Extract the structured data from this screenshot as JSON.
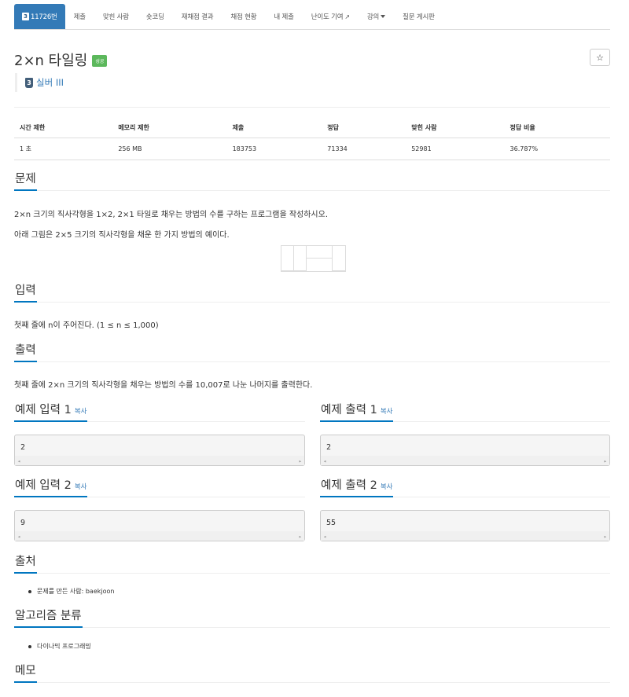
{
  "nav": {
    "problem_number": "11726번",
    "problem_tier": "3",
    "tabs": [
      "제출",
      "맞힌 사람",
      "숏코딩",
      "재채점 결과",
      "채점 현황",
      "내 제출",
      "난이도 기여",
      "강의",
      "질문 게시판"
    ]
  },
  "problem": {
    "title": "2×n 타일링",
    "status_label": "성공",
    "star_icon": "☆",
    "tier_badge": "3",
    "tier_name": "실버 III"
  },
  "info_table": {
    "headers": [
      "시간 제한",
      "메모리 제한",
      "제출",
      "정답",
      "맞힌 사람",
      "정답 비율"
    ],
    "values": [
      "1 초",
      "256 MB",
      "183753",
      "71334",
      "52981",
      "36.787%"
    ]
  },
  "sections": {
    "description_title": "문제",
    "description_p1": "2×n 크기의 직사각형을 1×2, 2×1 타일로 채우는 방법의 수를 구하는 프로그램을 작성하시오.",
    "description_p2": "아래 그림은 2×5 크기의 직사각형을 채운 한 가지 방법의 예이다.",
    "input_title": "입력",
    "input_text": "첫째 줄에 n이 주어진다. (1 ≤ n ≤ 1,000)",
    "output_title": "출력",
    "output_text": "첫째 줄에 2×n 크기의 직사각형을 채우는 방법의 수를 10,007로 나눈 나머지를 출력한다.",
    "source_title": "출처",
    "source_item": "문제를 만든 사람: baekjoon",
    "algorithm_title": "알고리즘 분류",
    "algorithm_item": "다이나믹 프로그래밍",
    "memo_title": "메모"
  },
  "samples": {
    "copy_label": "복사",
    "input1_title": "예제 입력 1",
    "output1_title": "예제 출력 1",
    "input2_title": "예제 입력 2",
    "output2_title": "예제 출력 2",
    "input1_value": "2",
    "output1_value": "2",
    "input2_value": "9",
    "output2_value": "55"
  },
  "colors": {
    "active_tab": "#337ab7",
    "success_label": "#5cb85c",
    "section_underline": "#0076c0"
  }
}
